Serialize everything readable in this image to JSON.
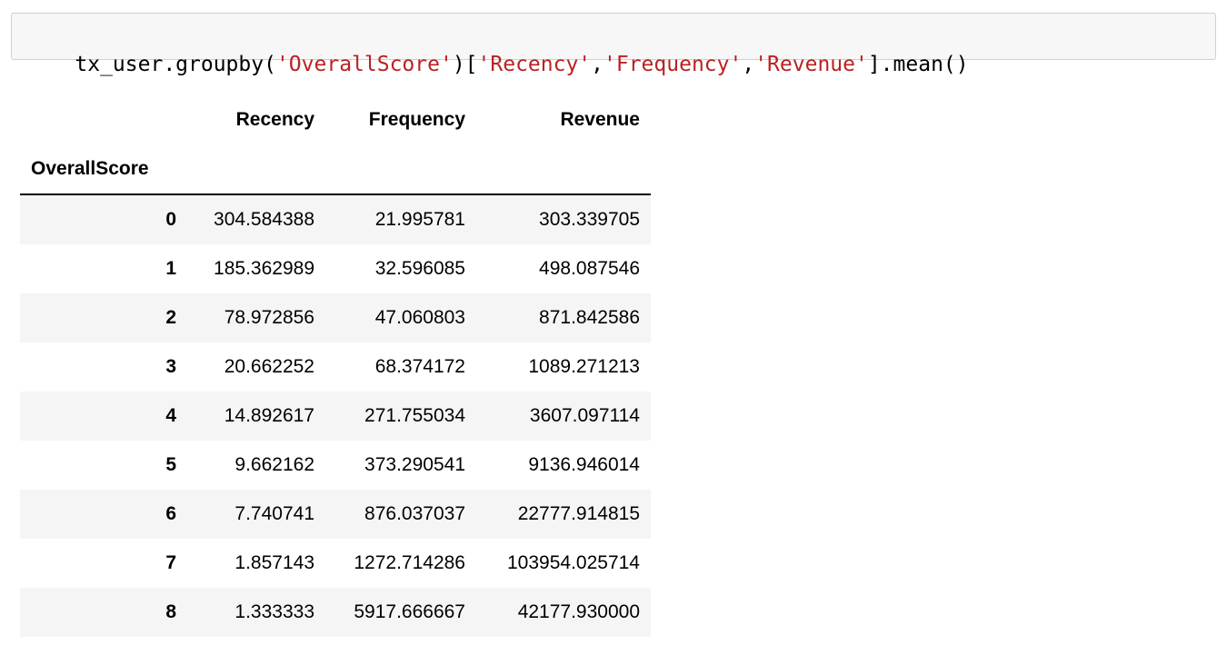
{
  "code_cell": {
    "tokens": [
      {
        "text": "tx_user.groupby(",
        "type": "plain"
      },
      {
        "text": "'OverallScore'",
        "type": "str"
      },
      {
        "text": ")[",
        "type": "plain"
      },
      {
        "text": "'Recency'",
        "type": "str"
      },
      {
        "text": ",",
        "type": "plain"
      },
      {
        "text": "'Frequency'",
        "type": "str"
      },
      {
        "text": ",",
        "type": "plain"
      },
      {
        "text": "'Revenue'",
        "type": "str"
      },
      {
        "text": "].mean()",
        "type": "plain"
      }
    ],
    "string_color": "#ba2121"
  },
  "dataframe": {
    "index_name": "OverallScore",
    "columns": [
      "Recency",
      "Frequency",
      "Revenue"
    ],
    "rows": [
      {
        "index": "0",
        "values": [
          "304.584388",
          "21.995781",
          "303.339705"
        ]
      },
      {
        "index": "1",
        "values": [
          "185.362989",
          "32.596085",
          "498.087546"
        ]
      },
      {
        "index": "2",
        "values": [
          "78.972856",
          "47.060803",
          "871.842586"
        ]
      },
      {
        "index": "3",
        "values": [
          "20.662252",
          "68.374172",
          "1089.271213"
        ]
      },
      {
        "index": "4",
        "values": [
          "14.892617",
          "271.755034",
          "3607.097114"
        ]
      },
      {
        "index": "5",
        "values": [
          "9.662162",
          "373.290541",
          "9136.946014"
        ]
      },
      {
        "index": "6",
        "values": [
          "7.740741",
          "876.037037",
          "22777.914815"
        ]
      },
      {
        "index": "7",
        "values": [
          "1.857143",
          "1272.714286",
          "103954.025714"
        ]
      },
      {
        "index": "8",
        "values": [
          "1.333333",
          "5917.666667",
          "42177.930000"
        ]
      }
    ]
  }
}
